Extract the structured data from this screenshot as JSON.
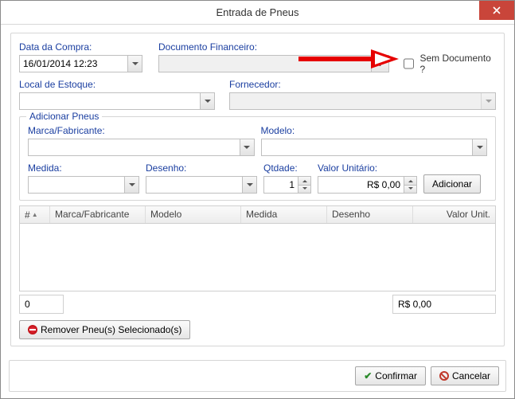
{
  "window": {
    "title": "Entrada de Pneus"
  },
  "labels": {
    "dataCompra": "Data da Compra:",
    "documentoFinanceiro": "Documento Financeiro:",
    "semDocumento": "Sem Documento ?",
    "localEstoque": "Local de Estoque:",
    "fornecedor": "Fornecedor:",
    "adicionarPneus": "Adicionar Pneus",
    "marcaFabricante": "Marca/Fabricante:",
    "modelo": "Modelo:",
    "medida": "Medida:",
    "desenho": "Desenho:",
    "qtdade": "Qtdade:",
    "valorUnitario": "Valor Unitário:",
    "adicionarBtn": "Adicionar",
    "removerBtn": "Remover Pneu(s) Selecionado(s)",
    "confirmar": "Confirmar",
    "cancelar": "Cancelar"
  },
  "values": {
    "dataCompra": "16/01/2014 12:23",
    "documentoFinanceiro": "",
    "semDocumentoChecked": false,
    "localEstoque": "",
    "fornecedor": "",
    "marcaFabricante": "",
    "modelo": "",
    "medida": "",
    "desenho": "",
    "qtdade": "1",
    "valorUnitario": "R$ 0,00",
    "footerCount": "0",
    "footerTotal": "R$ 0,00"
  },
  "grid": {
    "columns": {
      "num": "#",
      "marca": "Marca/Fabricante",
      "modelo": "Modelo",
      "medida": "Medida",
      "desenho": "Desenho",
      "valorUnit": "Valor Unit."
    }
  },
  "icons": {
    "plus": "+",
    "check": "✔",
    "cancel": "⦸"
  }
}
